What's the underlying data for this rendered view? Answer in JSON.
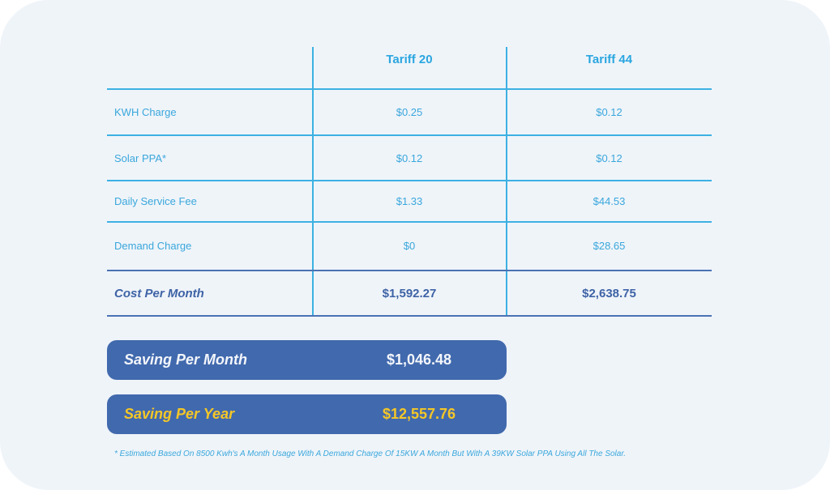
{
  "table": {
    "headers": [
      "",
      "Tariff 20",
      "Tariff 44"
    ],
    "rows": [
      {
        "label": "KWH Charge",
        "tariff20": "$0.25",
        "tariff44": "$0.12"
      },
      {
        "label": "Solar PPA*",
        "tariff20": "$0.12",
        "tariff44": "$0.12"
      },
      {
        "label": "Daily Service Fee",
        "tariff20": "$1.33",
        "tariff44": "$44.53"
      },
      {
        "label": "Demand Charge",
        "tariff20": "$0",
        "tariff44": "$28.65"
      }
    ],
    "total": {
      "label": "Cost Per Month",
      "tariff20": "$1,592.27",
      "tariff44": "$2,638.75"
    }
  },
  "savings": {
    "month": {
      "label": "Saving Per Month",
      "value": "$1,046.48"
    },
    "year": {
      "label": "Saving Per Year",
      "value": "$12,557.76"
    }
  },
  "footnote": "* Estimated Based On 8500 Kwh's A Month Usage With A Demand Charge Of 15KW A Month But With A 39KW Solar PPA Using All The Solar.",
  "colors": {
    "accent": "#3cb1e2",
    "dark_blue": "#4169ad",
    "highlight": "#f5c726",
    "background": "#eff4f9"
  }
}
